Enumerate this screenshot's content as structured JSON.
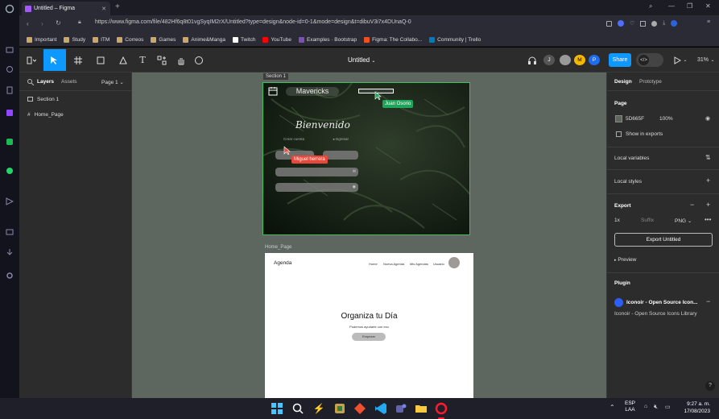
{
  "browser": {
    "tab_title": "Untitled – Figma",
    "url": "https://www.figma.com/file/482Hf6q8t01vgSyqIM2rX/Untitled?type=design&node-id=0-1&mode=design&t=dibuV3i7x4DUnaQ-0",
    "bookmarks": [
      {
        "label": "Important",
        "color": "#c9a86a"
      },
      {
        "label": "Study",
        "color": "#c9a86a"
      },
      {
        "label": "ITM",
        "color": "#c9a86a"
      },
      {
        "label": "Correos",
        "color": "#c9a86a"
      },
      {
        "label": "Games",
        "color": "#c9a86a"
      },
      {
        "label": "Anime&Manga",
        "color": "#c9a86a"
      },
      {
        "label": "Twitch",
        "color": "#ffffff"
      },
      {
        "label": "YouTube",
        "color": "#ff0000"
      },
      {
        "label": "Examples · Bootstrap",
        "color": "#7952b3"
      },
      {
        "label": "Figma: The Collabo...",
        "color": "#f24e1e"
      },
      {
        "label": "Community | Trello",
        "color": "#0079bf"
      }
    ]
  },
  "figma": {
    "file_title": "Untitled",
    "avatars": [
      {
        "initial": "J",
        "color": "#555555"
      },
      {
        "initial": "",
        "color": "#999999"
      },
      {
        "initial": "M",
        "color": "#f5b800"
      },
      {
        "initial": "P",
        "color": "#1e6cf0"
      }
    ],
    "share_label": "Share",
    "zoom": "31%",
    "left_panel": {
      "tab_layers": "Layers",
      "tab_assets": "Assets",
      "page_selector": "Page 1",
      "layers": [
        "Section 1",
        "Home_Page"
      ]
    },
    "right_panel": {
      "tab_design": "Design",
      "tab_prototype": "Prototype",
      "page_heading": "Page",
      "page_color": "5D665F",
      "page_opacity": "100%",
      "show_in_exports": "Show in exports",
      "local_variables": "Local variables",
      "local_styles": "Local styles",
      "export_heading": "Export",
      "export_scale": "1x",
      "export_suffix": "Suffix",
      "export_format": "PNG",
      "export_button": "Export Untitled",
      "preview": "Preview",
      "plugin_heading": "Plugin",
      "plugin_name": "Iconoir - Open Source Icon...",
      "plugin_desc": "Iconoir - Open Source Icons Library"
    },
    "canvas": {
      "section_label": "Section 1",
      "home_label": "Home_Page",
      "mavericks": "Mavericks",
      "bienvenido": "Bienvenido",
      "crear_cuenta": "Crear cuenta",
      "ingresar": "Ingresar",
      "cursor_juan": "Juan Osorio",
      "cursor_miguel": "Miguel herrera",
      "home_logo": "Agenda",
      "home_nav": [
        "Home",
        "Nueva Agenda",
        "Mis Agendas",
        "Usuario"
      ],
      "home_heading": "Organiza tu Día",
      "home_sub": "Podemos ayudarte con eso",
      "home_button": "Empezar"
    }
  },
  "taskbar": {
    "lang": "ESP",
    "lang2": "LAA",
    "time": "9:27 a. m.",
    "date": "17/08/2023"
  },
  "colors": {
    "canvas_bg": "#5D665F",
    "figma_blue": "#0d99ff",
    "selection_green": "#3fbf5f",
    "cursor_juan": "#1ea55b",
    "cursor_miguel": "#e8473a"
  }
}
